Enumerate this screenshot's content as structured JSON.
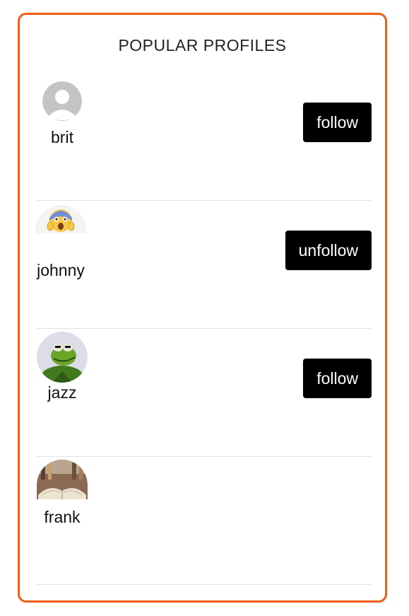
{
  "title": "POPULAR PROFILES",
  "colors": {
    "border_accent": "#f25c14",
    "button_bg": "#000000",
    "button_text": "#ffffff"
  },
  "profiles": [
    {
      "username": "brit",
      "avatar_icon": "default-avatar-icon",
      "button_label": "follow"
    },
    {
      "username": "johnny",
      "avatar_icon": "screaming-face-emoji-avatar",
      "button_label": "unfollow"
    },
    {
      "username": "jazz",
      "avatar_icon": "kermit-frog-avatar",
      "button_label": "follow"
    },
    {
      "username": "frank",
      "avatar_icon": "open-book-avatar"
    }
  ]
}
